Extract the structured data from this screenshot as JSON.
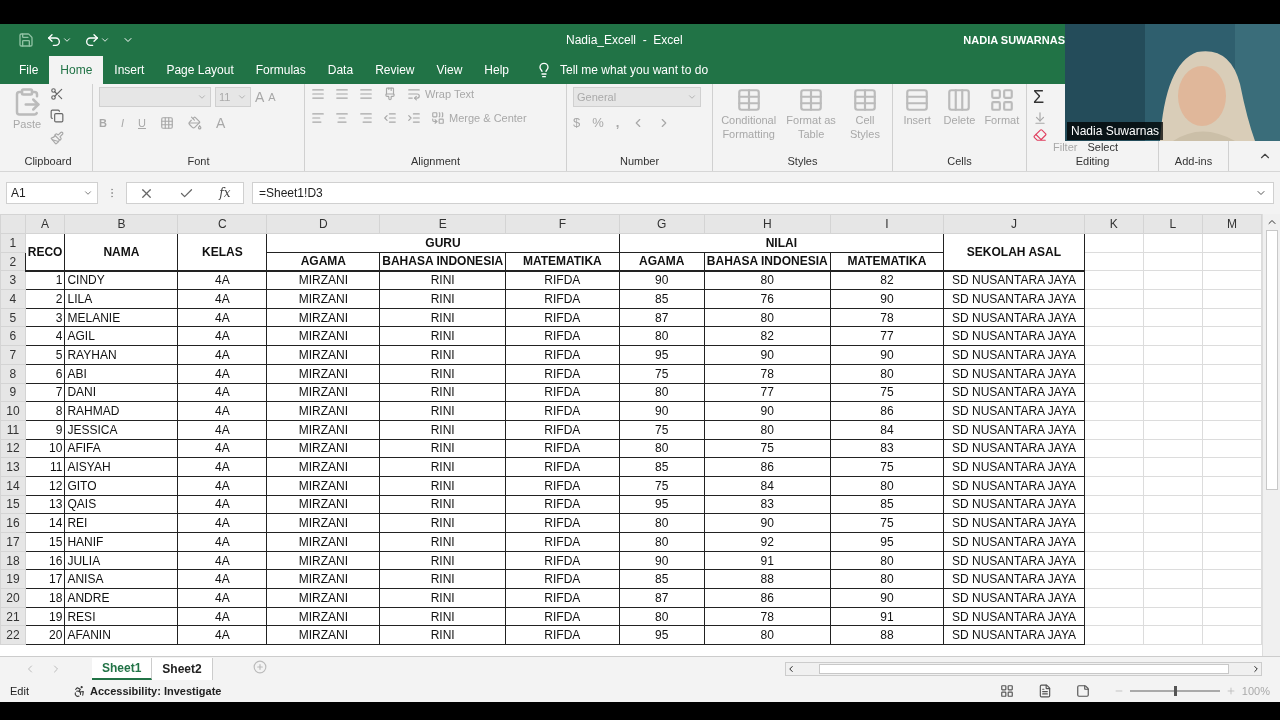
{
  "title_bar": {
    "document": "Nadia_Excell",
    "separator": "-",
    "app": "Excel",
    "user": "NADIA SUWARNAS"
  },
  "menu_tabs": [
    {
      "label": "File",
      "selected": false
    },
    {
      "label": "Home",
      "selected": true
    },
    {
      "label": "Insert",
      "selected": false
    },
    {
      "label": "Page Layout",
      "selected": false
    },
    {
      "label": "Formulas",
      "selected": false
    },
    {
      "label": "Data",
      "selected": false
    },
    {
      "label": "Review",
      "selected": false
    },
    {
      "label": "View",
      "selected": false
    },
    {
      "label": "Help",
      "selected": false
    }
  ],
  "tell_me": "Tell me what you want to do",
  "ribbon": {
    "disabled": true,
    "groups": [
      {
        "kind": "clipboard",
        "label": "Clipboard",
        "paste": "Paste"
      },
      {
        "kind": "font",
        "label": "Font",
        "size": "11",
        "bold": "B",
        "italic": "I",
        "underline": "U",
        "grow": "A",
        "shrink": "A",
        "font_color": "A"
      },
      {
        "kind": "alignment",
        "label": "Alignment",
        "wrap": "Wrap Text",
        "merge": "Merge & Center"
      },
      {
        "kind": "number",
        "label": "Number",
        "format": "General",
        "currency": "$",
        "percent": "%",
        "comma": ","
      },
      {
        "kind": "styles",
        "label": "Styles",
        "buttons": [
          "Conditional Formatting",
          "Format as Table",
          "Cell Styles"
        ]
      },
      {
        "kind": "cells",
        "label": "Cells",
        "buttons": [
          "Insert",
          "Delete",
          "Format"
        ]
      },
      {
        "kind": "editing",
        "label": "Editing",
        "sum": "Σ",
        "filter": "Filter",
        "select": "Select"
      },
      {
        "kind": "addins",
        "label": "Add-ins"
      }
    ]
  },
  "formula_bar": {
    "name_box": "A1",
    "fx": "fx",
    "formula": "=Sheet1!D3"
  },
  "sheet": {
    "columns": [
      "A",
      "B",
      "C",
      "D",
      "E",
      "F",
      "G",
      "H",
      "I",
      "J",
      "K",
      "L",
      "M"
    ],
    "headers": {
      "reco": "RECO",
      "nama": "NAMA",
      "kelas": "KELAS",
      "guru": "GURU",
      "nilai": "NILAI",
      "sekolah": "SEKOLAH ASAL",
      "row_labels": [
        "1",
        "2"
      ],
      "guru_subjects": [
        "AGAMA",
        "BAHASA INDONESIA",
        "MATEMATIKA"
      ],
      "nilai_subjects": [
        "AGAMA",
        "BAHASA INDONESIA",
        "MATEMATIKA"
      ]
    },
    "row_numbers": [
      "3",
      "4",
      "5",
      "6",
      "7",
      "8",
      "9",
      "10",
      "11",
      "12",
      "13",
      "14",
      "15",
      "16",
      "17",
      "18",
      "19",
      "20",
      "21",
      "22"
    ],
    "rows": [
      [
        "1",
        "CINDY",
        "4A",
        "MIRZANI",
        "RINI",
        "RIFDA",
        "90",
        "80",
        "82",
        "SD NUSANTARA JAYA"
      ],
      [
        "2",
        "LILA",
        "4A",
        "MIRZANI",
        "RINI",
        "RIFDA",
        "85",
        "76",
        "90",
        "SD NUSANTARA JAYA"
      ],
      [
        "3",
        "MELANIE",
        "4A",
        "MIRZANI",
        "RINI",
        "RIFDA",
        "87",
        "80",
        "78",
        "SD NUSANTARA JAYA"
      ],
      [
        "4",
        "AGIL",
        "4A",
        "MIRZANI",
        "RINI",
        "RIFDA",
        "80",
        "82",
        "77",
        "SD NUSANTARA JAYA"
      ],
      [
        "5",
        "RAYHAN",
        "4A",
        "MIRZANI",
        "RINI",
        "RIFDA",
        "95",
        "90",
        "90",
        "SD NUSANTARA JAYA"
      ],
      [
        "6",
        "ABI",
        "4A",
        "MIRZANI",
        "RINI",
        "RIFDA",
        "75",
        "78",
        "80",
        "SD NUSANTARA JAYA"
      ],
      [
        "7",
        "DANI",
        "4A",
        "MIRZANI",
        "RINI",
        "RIFDA",
        "80",
        "77",
        "75",
        "SD NUSANTARA JAYA"
      ],
      [
        "8",
        "RAHMAD",
        "4A",
        "MIRZANI",
        "RINI",
        "RIFDA",
        "90",
        "90",
        "86",
        "SD NUSANTARA JAYA"
      ],
      [
        "9",
        "JESSICA",
        "4A",
        "MIRZANI",
        "RINI",
        "RIFDA",
        "75",
        "80",
        "84",
        "SD NUSANTARA JAYA"
      ],
      [
        "10",
        "AFIFA",
        "4A",
        "MIRZANI",
        "RINI",
        "RIFDA",
        "80",
        "75",
        "83",
        "SD NUSANTARA JAYA"
      ],
      [
        "11",
        "AISYAH",
        "4A",
        "MIRZANI",
        "RINI",
        "RIFDA",
        "85",
        "86",
        "75",
        "SD NUSANTARA JAYA"
      ],
      [
        "12",
        "GITO",
        "4A",
        "MIRZANI",
        "RINI",
        "RIFDA",
        "75",
        "84",
        "80",
        "SD NUSANTARA JAYA"
      ],
      [
        "13",
        "QAIS",
        "4A",
        "MIRZANI",
        "RINI",
        "RIFDA",
        "95",
        "83",
        "85",
        "SD NUSANTARA JAYA"
      ],
      [
        "14",
        "REI",
        "4A",
        "MIRZANI",
        "RINI",
        "RIFDA",
        "80",
        "90",
        "75",
        "SD NUSANTARA JAYA"
      ],
      [
        "15",
        "HANIF",
        "4A",
        "MIRZANI",
        "RINI",
        "RIFDA",
        "80",
        "92",
        "95",
        "SD NUSANTARA JAYA"
      ],
      [
        "16",
        "JULIA",
        "4A",
        "MIRZANI",
        "RINI",
        "RIFDA",
        "90",
        "91",
        "80",
        "SD NUSANTARA JAYA"
      ],
      [
        "17",
        "ANISA",
        "4A",
        "MIRZANI",
        "RINI",
        "RIFDA",
        "85",
        "88",
        "80",
        "SD NUSANTARA JAYA"
      ],
      [
        "18",
        "ANDRE",
        "4A",
        "MIRZANI",
        "RINI",
        "RIFDA",
        "87",
        "86",
        "90",
        "SD NUSANTARA JAYA"
      ],
      [
        "19",
        "RESI",
        "4A",
        "MIRZANI",
        "RINI",
        "RIFDA",
        "80",
        "78",
        "91",
        "SD NUSANTARA JAYA"
      ],
      [
        "20",
        "AFANIN",
        "4A",
        "MIRZANI",
        "RINI",
        "RIFDA",
        "95",
        "80",
        "88",
        "SD NUSANTARA JAYA"
      ]
    ]
  },
  "sheet_tabs": [
    {
      "label": "Sheet1",
      "selected": true
    },
    {
      "label": "Sheet2",
      "selected": false
    }
  ],
  "status_bar": {
    "mode": "Edit",
    "accessibility": "Accessibility: Investigate",
    "zoom": {
      "level": 0.5,
      "reading": "100%"
    }
  },
  "webcam": {
    "kind": "picture",
    "name_label": "Nadia Suwarnas"
  }
}
